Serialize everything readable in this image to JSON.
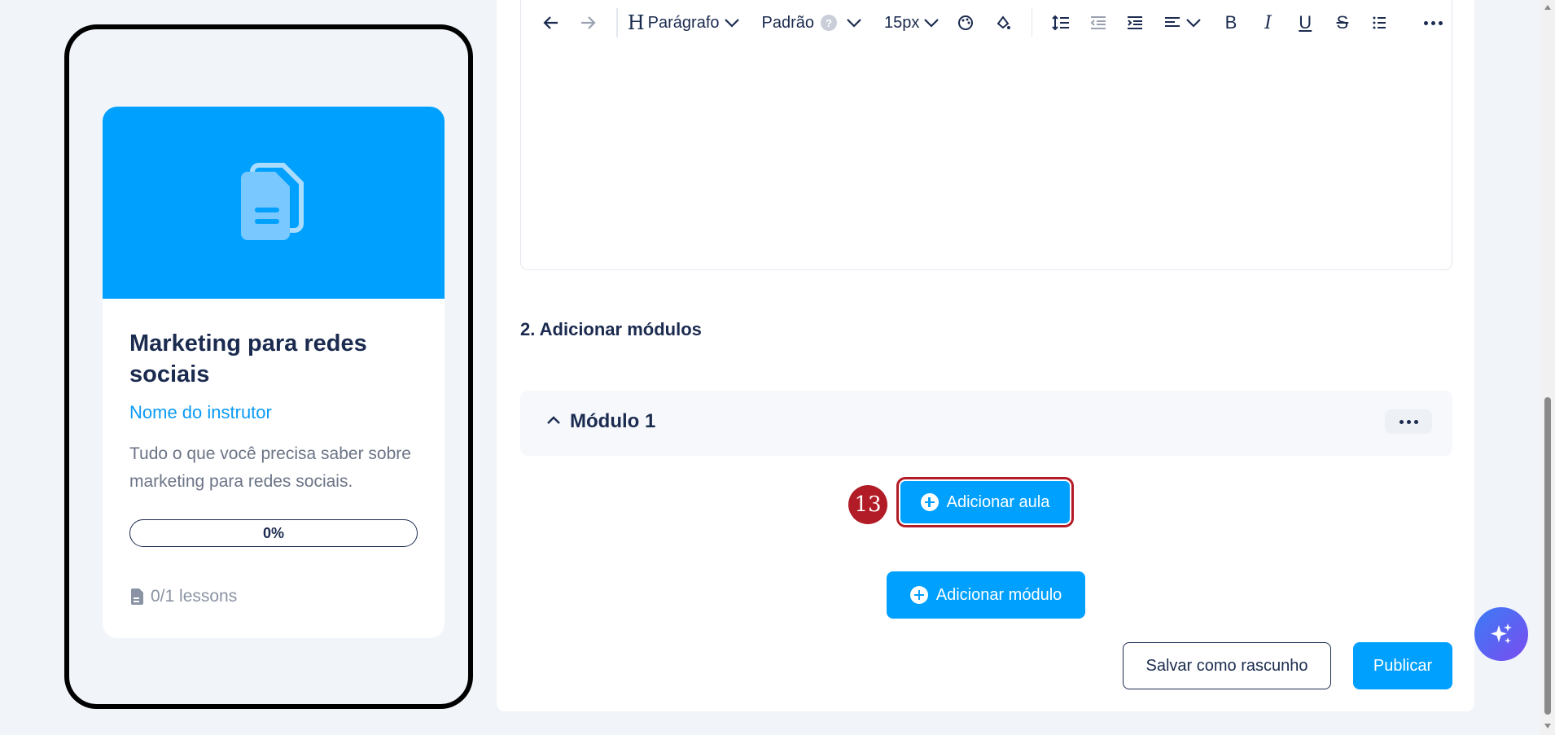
{
  "preview": {
    "title": "Marketing para redes sociais",
    "instructor": "Nome do instrutor",
    "description": "Tudo o que você precisa saber sobre marketing para redes sociais.",
    "progress_label": "0%",
    "progress_value": 0,
    "lessons": "0/1 lessons",
    "banner_color": "#00a0fe",
    "banner_icon": "document-icon"
  },
  "toolbar": {
    "block_type": "Parágrafo",
    "font": "Padrão",
    "help": "?",
    "font_size": "15px"
  },
  "section": {
    "title": "2. Adicionar módulos"
  },
  "module": {
    "name": "Módulo 1"
  },
  "step_badge": "13",
  "buttons": {
    "add_lesson": "Adicionar aula",
    "add_module": "Adicionar módulo",
    "save_draft": "Salvar como rascunho",
    "publish": "Publicar"
  },
  "colors": {
    "accent": "#00a0fe",
    "text": "#1b2b4f",
    "highlight": "#b21c27"
  }
}
